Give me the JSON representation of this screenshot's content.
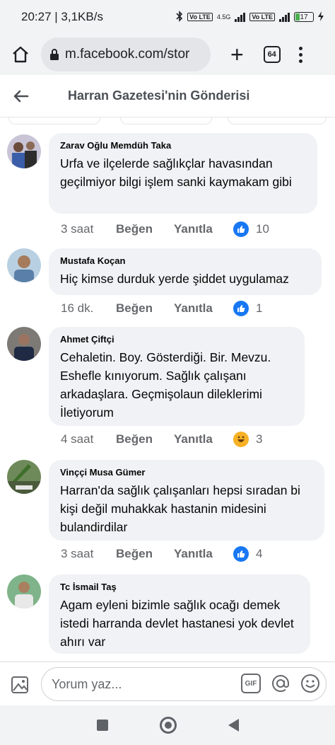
{
  "status": {
    "time": "20:27",
    "speed": "3,1KB/s",
    "net1": "4.5G",
    "volte": "Vo LTE",
    "battery": "17"
  },
  "browser": {
    "url": "m.facebook.com/stor",
    "tab_count": "64"
  },
  "header": {
    "title": "Harran Gazetesi'nin Gönderisi"
  },
  "comments": [
    {
      "author": "Zarav Oğlu Memdüh Taka",
      "text": "Urfa  ve ilçelerde  sağlıkçlar havasından geçilmiyor  bilgi işlem sanki  kaymakam gibi",
      "time": "3 saat",
      "like_label": "Beğen",
      "reply_label": "Yanıtla",
      "reaction": "like",
      "reaction_count": "10"
    },
    {
      "author": "Mustafa Koçan",
      "text": "Hiç kimse durduk yerde şiddet uygulamaz",
      "time": "16 dk.",
      "like_label": "Beğen",
      "reply_label": "Yanıtla",
      "reaction": "like",
      "reaction_count": "1"
    },
    {
      "author": "Ahmet Çiftçi",
      "text": "Cehaletin. Boy. Gösterdiği.  Bir. Mevzu. Eshefle kınıyorum.   Sağlık çalışanı arkadaşlara. Geçmişolaun dileklerimi İletiyorum",
      "time": "4 saat",
      "like_label": "Beğen",
      "reply_label": "Yanıtla",
      "reaction": "haha",
      "reaction_count": "3"
    },
    {
      "author": "Vinççi Musa Gümer",
      "text": "Harran'da sağlık çalışanları hepsi sıradan bi kişi değil  muhakkak hastanin midesini bulandirdilar",
      "time": "3 saat",
      "like_label": "Beğen",
      "reply_label": "Yanıtla",
      "reaction": "like",
      "reaction_count": "4"
    },
    {
      "author": "Tc İsmail Taş",
      "text": "Agam eyleni bizimle sağlık ocağı demek istedi harranda devlet hastanesi  yok devlet ahırı var"
    }
  ],
  "composer": {
    "placeholder": "Yorum yaz...",
    "gif_label": "GIF"
  },
  "colors": {
    "facebook_blue": "#1877f2",
    "bubble_bg": "#f0f2f5",
    "meta_gray": "#65676b"
  }
}
